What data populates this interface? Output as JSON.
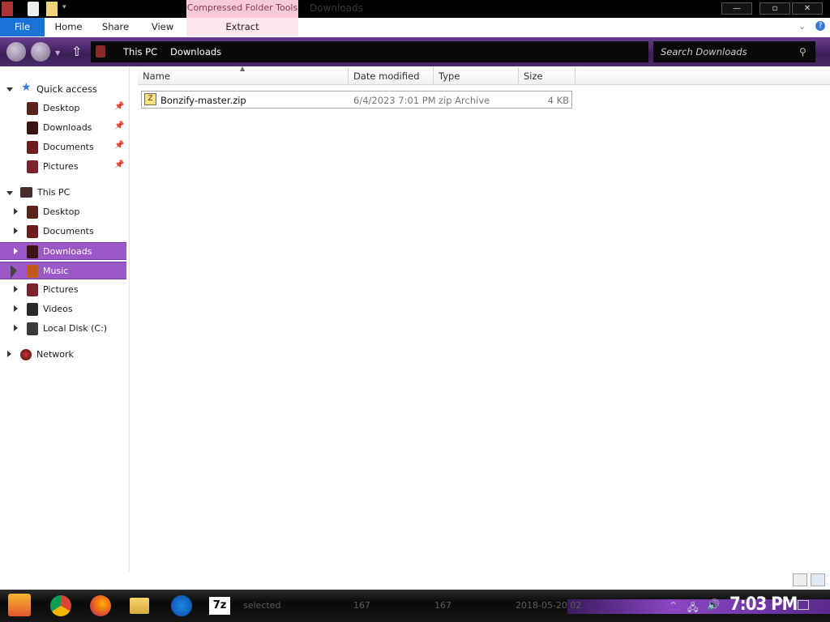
{
  "title_bar": {
    "window_title": "Downloads",
    "context_tab": "Compressed Folder Tools",
    "controls": {
      "minimize": "—",
      "maximize": "▫",
      "close": "✕"
    }
  },
  "ribbon": {
    "tabs": [
      "File",
      "Home",
      "Share",
      "View",
      "Extract"
    ],
    "expand": "⌄",
    "help": "?"
  },
  "address": {
    "breadcrumbs": [
      "This PC",
      "Downloads"
    ],
    "search_placeholder": "Search Downloads"
  },
  "nav": {
    "quick_access": {
      "label": "Quick access",
      "items": [
        "Desktop",
        "Downloads",
        "Documents",
        "Pictures"
      ]
    },
    "this_pc": {
      "label": "This PC",
      "items": [
        "Desktop",
        "Documents",
        "Downloads",
        "Music",
        "Pictures",
        "Videos",
        "Local Disk (C:)"
      ]
    },
    "network": "Network"
  },
  "columns": [
    "Name",
    "Date modified",
    "Type",
    "Size"
  ],
  "files": [
    {
      "name": "Bonzify-master.zip",
      "date": "6/4/2023 7:01 PM",
      "type": "zip Archive",
      "size": "4 KB"
    }
  ],
  "taskbar": {
    "ghost_status": "selected",
    "ghost_values": [
      "167",
      "167",
      "2018-05-20 02"
    ],
    "clock": "7:03 PM",
    "app_7z": "7z"
  },
  "colors": {
    "accent_purple": "#9a59c7",
    "file_tab_blue": "#1a73d6",
    "context_pink": "#f7c9d9"
  }
}
